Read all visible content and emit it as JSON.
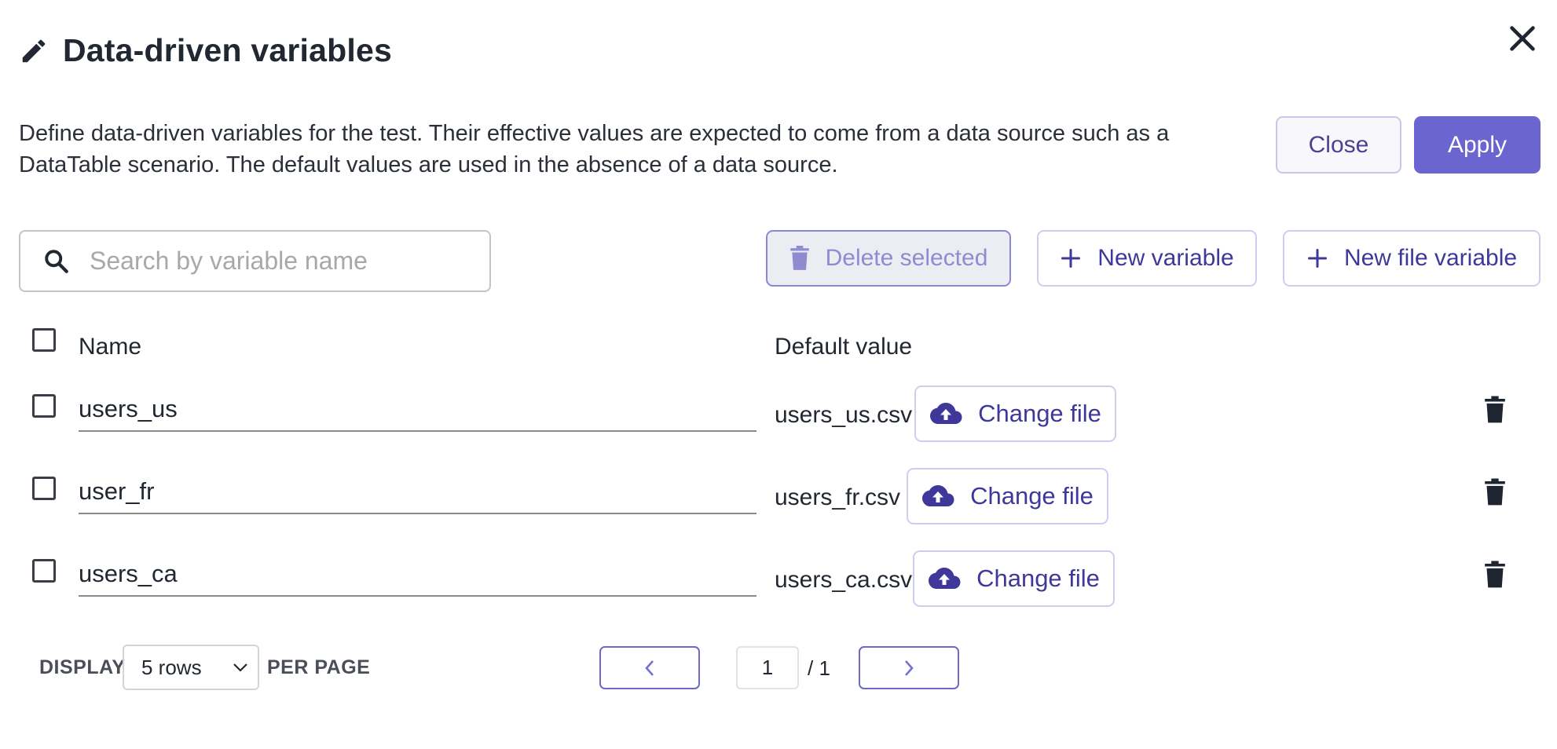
{
  "header": {
    "title": "Data-driven variables",
    "description": "Define data-driven variables for the test. Their effective values are expected to come from a data source such as a DataTable scenario. The default values are used in the absence of a data source.",
    "icons": {
      "title": "pencil-icon",
      "close": "close-icon"
    }
  },
  "actions": {
    "close_label": "Close",
    "apply_label": "Apply"
  },
  "toolbar": {
    "search_placeholder": "Search by variable name",
    "search_value": "",
    "delete_selected_label": "Delete selected",
    "new_variable_label": "New variable",
    "new_file_variable_label": "New file variable"
  },
  "table": {
    "columns": {
      "name": "Name",
      "default_value": "Default value"
    },
    "rows": [
      {
        "name": "users_us",
        "file": "users_us.csv",
        "change_label": "Change file",
        "checked": false
      },
      {
        "name": "user_fr",
        "file": "users_fr.csv",
        "change_label": "Change file",
        "checked": false
      },
      {
        "name": "users_ca",
        "file": "users_ca.csv",
        "change_label": "Change file",
        "checked": false
      }
    ]
  },
  "pagination": {
    "display_label": "DISPLAY",
    "rows_option": "5 rows",
    "per_page_label": "PER PAGE",
    "current_page": "1",
    "total_pages": "/ 1"
  },
  "colors": {
    "accent": "#6b66cf",
    "accent_text": "#3f3799",
    "disabled_text": "#8f8bd0",
    "text": "#222831"
  }
}
